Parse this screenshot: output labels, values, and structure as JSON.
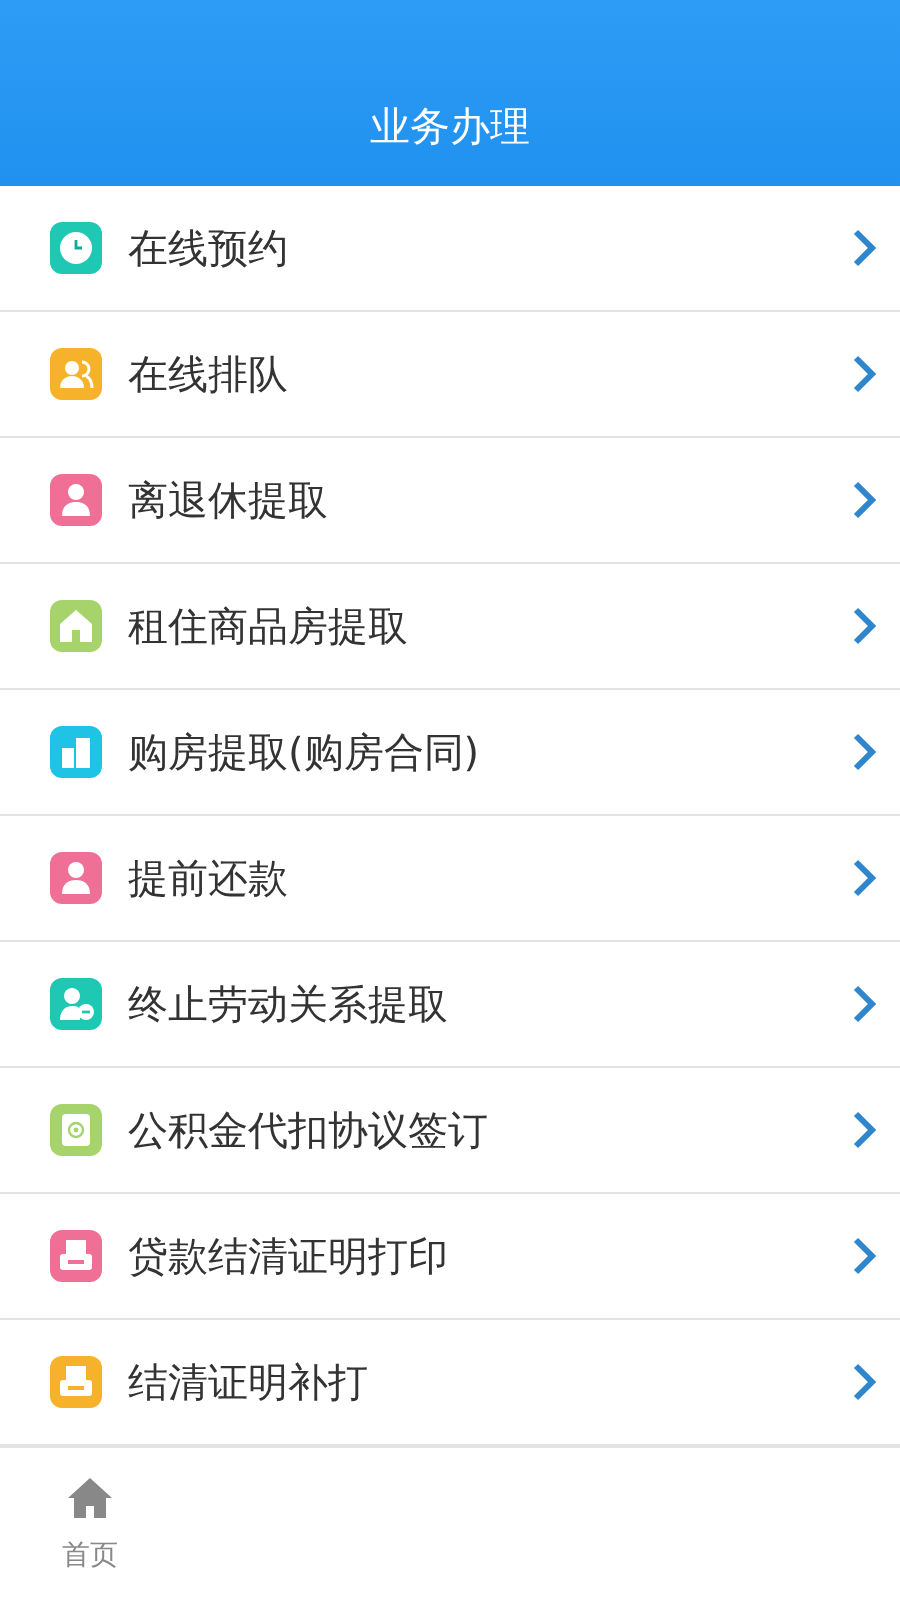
{
  "header": {
    "title": "业务办理"
  },
  "items": [
    {
      "label": "在线预约",
      "color": "#1ec8b2"
    },
    {
      "label": "在线排队",
      "color": "#f6b22a"
    },
    {
      "label": "离退休提取",
      "color": "#f06f96"
    },
    {
      "label": "租住商品房提取",
      "color": "#a6d36c"
    },
    {
      "label": "购房提取(购房合同)",
      "color": "#1fc3e6"
    },
    {
      "label": "提前还款",
      "color": "#f06f96"
    },
    {
      "label": "终止劳动关系提取",
      "color": "#1ec8b2"
    },
    {
      "label": "公积金代扣协议签订",
      "color": "#a6d36c"
    },
    {
      "label": "贷款结清证明打印",
      "color": "#f06f96"
    },
    {
      "label": "结清证明补打",
      "color": "#f6b22a"
    }
  ],
  "tab_bar": [
    {
      "label": "首页",
      "selected": false
    }
  ]
}
